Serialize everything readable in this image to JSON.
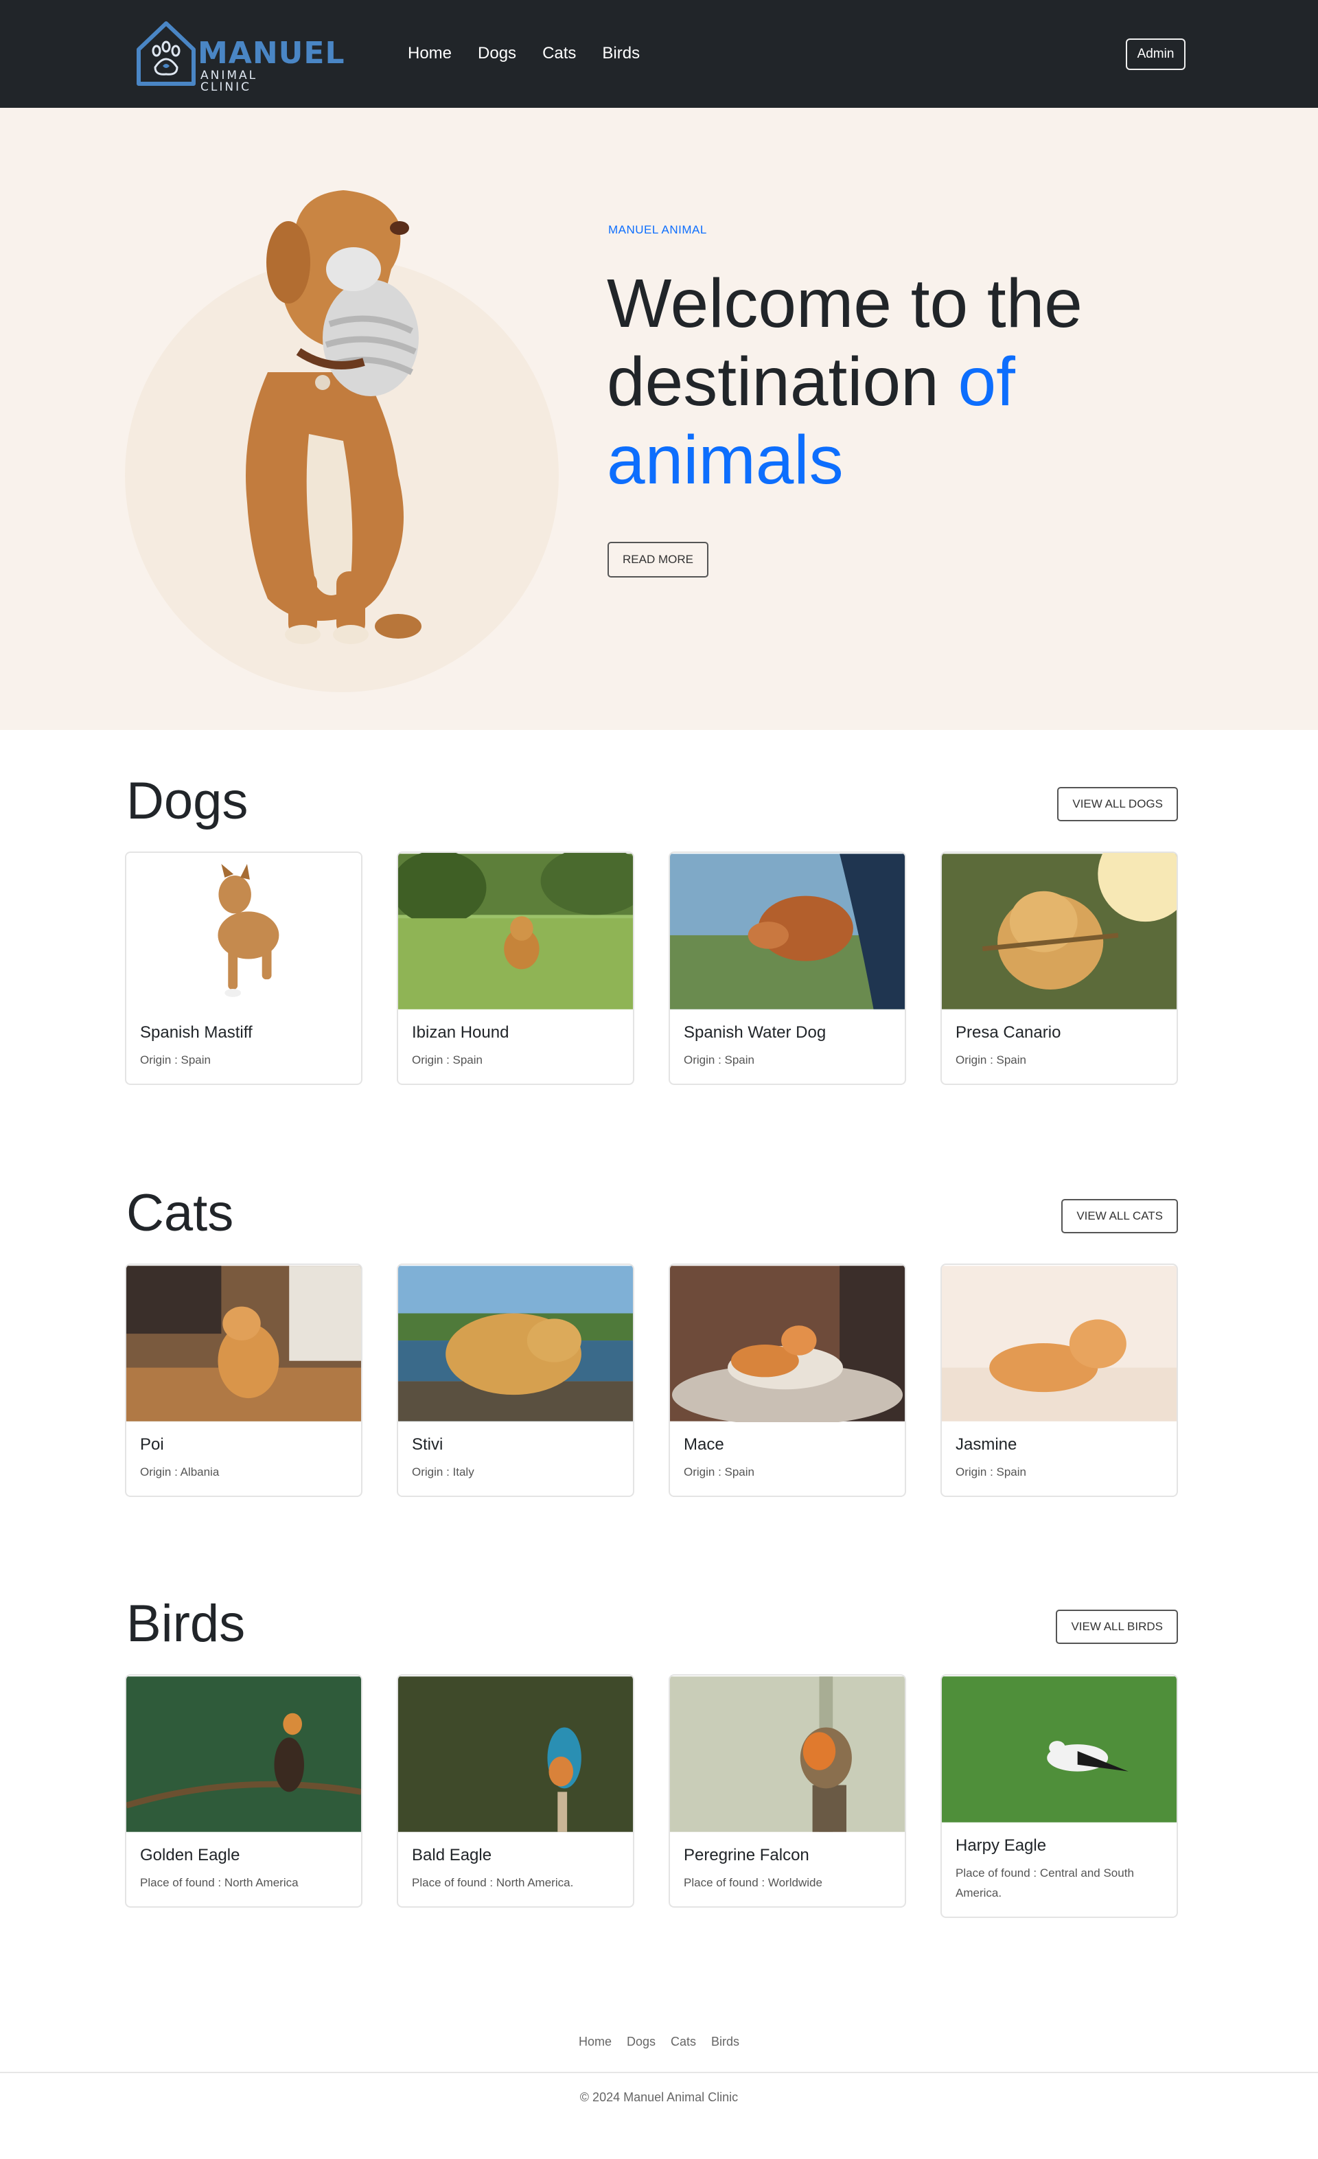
{
  "brand": {
    "title": "MANUEL",
    "subtitle": "ANIMAL CLINIC"
  },
  "nav": {
    "items": [
      "Home",
      "Dogs",
      "Cats",
      "Birds"
    ],
    "admin_label": "Admin"
  },
  "hero": {
    "kicker": "MANUEL ANIMAL",
    "title_line1": "Welcome to the",
    "title_line2": "destination",
    "title_accent1": "of",
    "title_accent2": "animals",
    "button_label": "READ MORE"
  },
  "sections": {
    "dogs": {
      "title": "Dogs",
      "button_label": "VIEW ALL DOGS",
      "cards": [
        {
          "name": "Spanish Mastiff",
          "detail": "Origin : Spain"
        },
        {
          "name": "Ibizan Hound",
          "detail": "Origin : Spain"
        },
        {
          "name": "Spanish Water Dog",
          "detail": "Origin : Spain"
        },
        {
          "name": "Presa Canario",
          "detail": "Origin : Spain"
        }
      ]
    },
    "cats": {
      "title": "Cats",
      "button_label": "VIEW ALL CATS",
      "cards": [
        {
          "name": "Poi",
          "detail": "Origin : Albania"
        },
        {
          "name": "Stivi",
          "detail": "Origin : Italy"
        },
        {
          "name": "Mace",
          "detail": "Origin : Spain"
        },
        {
          "name": "Jasmine",
          "detail": "Origin : Spain"
        }
      ]
    },
    "birds": {
      "title": "Birds",
      "button_label": "VIEW ALL BIRDS",
      "cards": [
        {
          "name": "Golden Eagle",
          "detail": "Place of found : North America"
        },
        {
          "name": "Bald Eagle",
          "detail": "Place of found : North America."
        },
        {
          "name": "Peregrine Falcon",
          "detail": "Place of found : Worldwide"
        },
        {
          "name": "Harpy Eagle",
          "detail": "Place of found : Central and South America."
        }
      ]
    }
  },
  "footer": {
    "links": [
      "Home",
      "Dogs",
      "Cats",
      "Birds"
    ],
    "copyright": "© 2024 Manuel Animal Clinic"
  },
  "colors": {
    "navbar": "#212529",
    "hero_bg": "#f9f2ec",
    "accent": "#0d6efd",
    "logo": "#4a86c5"
  }
}
